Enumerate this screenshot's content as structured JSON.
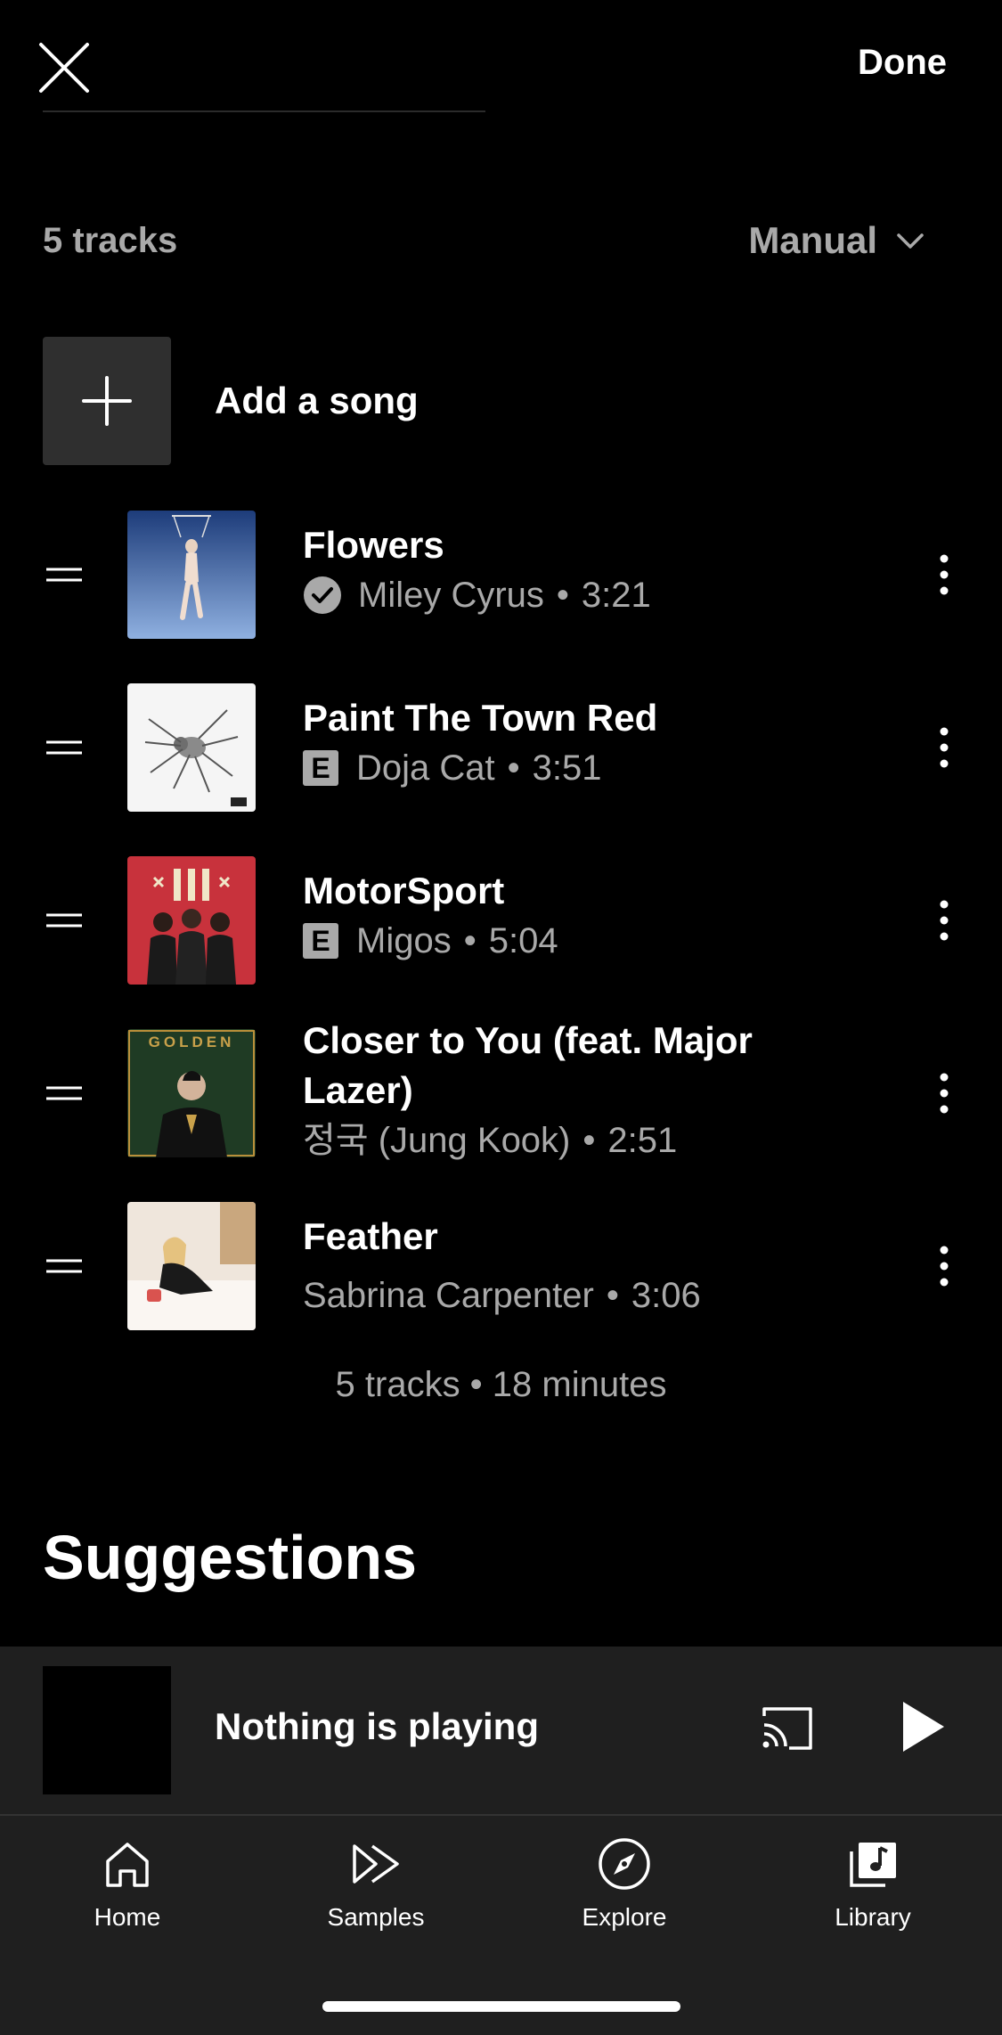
{
  "header": {
    "done_label": "Done"
  },
  "playlist": {
    "track_count_label": "5 tracks",
    "sort_label": "Manual",
    "add_song_label": "Add a song",
    "tracks": [
      {
        "title": "Flowers",
        "artist": "Miley Cyrus",
        "duration": "3:21",
        "badge": "verified"
      },
      {
        "title": "Paint The Town Red",
        "artist": "Doja Cat",
        "duration": "3:51",
        "badge": "explicit",
        "badge_text": "E"
      },
      {
        "title": "MotorSport",
        "artist": "Migos",
        "duration": "5:04",
        "badge": "explicit",
        "badge_text": "E"
      },
      {
        "title": "Closer to You (feat. Major Lazer)",
        "artist": "정국 (Jung Kook)",
        "duration": "2:51",
        "badge": ""
      },
      {
        "title": "Feather",
        "artist": "Sabrina Carpenter",
        "duration": "3:06",
        "badge": ""
      }
    ],
    "separator": "•",
    "summary": "5 tracks • 18 minutes",
    "album_art_texts": {
      "closer_to_you": "GOLDEN"
    }
  },
  "suggestions": {
    "heading": "Suggestions"
  },
  "mini_player": {
    "status": "Nothing is playing"
  },
  "bottom_nav": {
    "items": [
      {
        "label": "Home",
        "icon": "home-icon"
      },
      {
        "label": "Samples",
        "icon": "samples-icon"
      },
      {
        "label": "Explore",
        "icon": "explore-icon"
      },
      {
        "label": "Library",
        "icon": "library-icon",
        "active": true
      }
    ]
  },
  "colors": {
    "background": "#000000",
    "secondary_text": "#a9a9a9",
    "panel": "#1f1f1f",
    "add_tile": "#2f2f2f"
  }
}
